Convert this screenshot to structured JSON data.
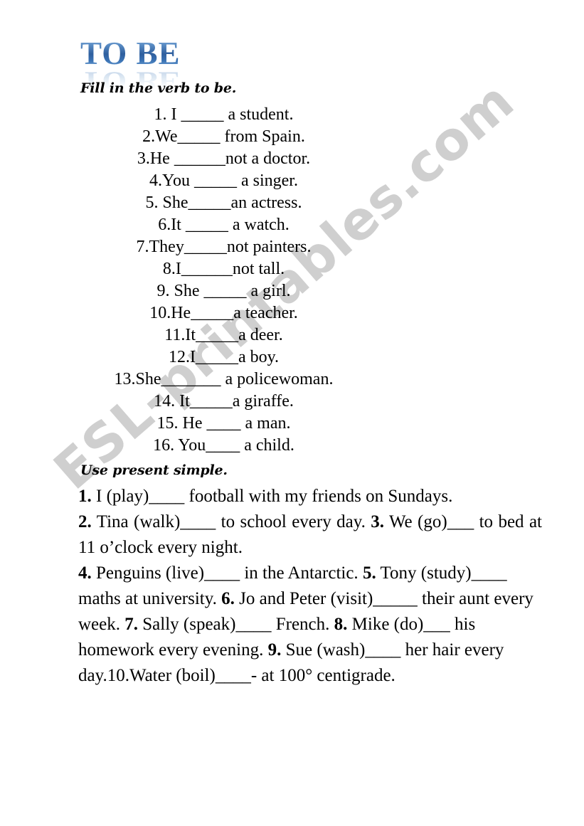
{
  "document": {
    "title_main": "TO BE",
    "title_reflection": "TO BE",
    "title_color": "#2f5f9e",
    "background_color": "#ffffff",
    "text_color": "#000000"
  },
  "watermark": {
    "text": "ESL-printables.com",
    "color": "#cfcfcf"
  },
  "section_tobe": {
    "instruction": "Fill in the verb to be.",
    "items": [
      "1. I _____ a student.",
      "2.We_____ from Spain.",
      "3.He ______not a doctor.",
      "4.You _____ a singer.",
      "5. She_____an actress.",
      "6.It _____ a watch.",
      "7.They_____not painters.",
      "8.I______not tall.",
      "9. She _____ a girl.",
      "10.He_____a teacher.",
      "11.It_____a deer.",
      "12.I_____a boy.",
      "13.She_______ a policewoman.",
      "14.  It_____a giraffe.",
      "15. He ____ a man.",
      "16. You____ a child."
    ]
  },
  "section_present_simple": {
    "instruction": "Use present simple.",
    "paragraphs": [
      {
        "segments": [
          {
            "bold": true,
            "text": "1."
          },
          {
            "bold": false,
            "text": " I (play)____ football with my friends on Sundays."
          }
        ]
      },
      {
        "segments": [
          {
            "bold": true,
            "text": "2."
          },
          {
            "bold": false,
            "text": " Tina (walk)____ to school every day. "
          },
          {
            "bold": true,
            "text": "3."
          },
          {
            "bold": false,
            "text": " We (go)___ to bed at 11 o’clock every night."
          }
        ]
      },
      {
        "segments": [
          {
            "bold": true,
            "text": "4."
          },
          {
            "bold": false,
            "text": " Penguins (live)____ in the Antarctic. "
          },
          {
            "bold": true,
            "text": "5."
          },
          {
            "bold": false,
            "text": " Tony (study)____ maths at university. "
          },
          {
            "bold": true,
            "text": "6."
          },
          {
            "bold": false,
            "text": " Jo and Peter (visit)_____ their aunt every week. "
          },
          {
            "bold": true,
            "text": "7."
          },
          {
            "bold": false,
            "text": " Sally (speak)____ French. "
          },
          {
            "bold": true,
            "text": "8."
          },
          {
            "bold": false,
            "text": " Mike (do)___ his homework every evening. "
          },
          {
            "bold": true,
            "text": "9."
          },
          {
            "bold": false,
            "text": " Sue (wash)____ her hair every day.10.Water (boil)____- at 100° centigrade."
          }
        ]
      }
    ]
  }
}
